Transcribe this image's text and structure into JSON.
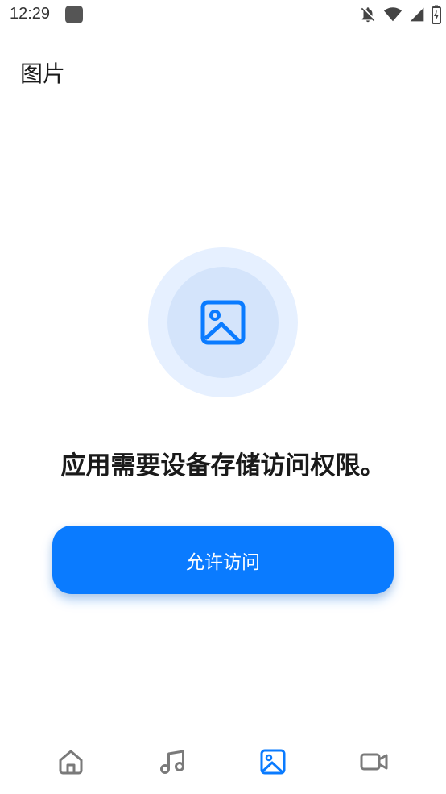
{
  "status_bar": {
    "time": "12:29",
    "icons": [
      "app-notification-icon",
      "bell-off-icon",
      "wifi-icon",
      "cellular-signal-icon",
      "battery-charging-icon"
    ]
  },
  "header": {
    "title": "图片"
  },
  "hero": {
    "icon": "image-icon"
  },
  "message": "应用需要设备存储访问权限。",
  "action_button": {
    "label": "允许访问"
  },
  "bottom_nav": {
    "items": [
      {
        "icon": "home-icon",
        "active": false
      },
      {
        "icon": "music-note-icon",
        "active": false
      },
      {
        "icon": "image-icon",
        "active": true
      },
      {
        "icon": "video-camera-icon",
        "active": false
      }
    ]
  },
  "colors": {
    "accent": "#0a7bff",
    "hero_outer": "#e6f0ff",
    "hero_inner": "#d4e4fb",
    "nav_inactive": "#7a7a7a",
    "text_primary": "#1a1a1a"
  }
}
